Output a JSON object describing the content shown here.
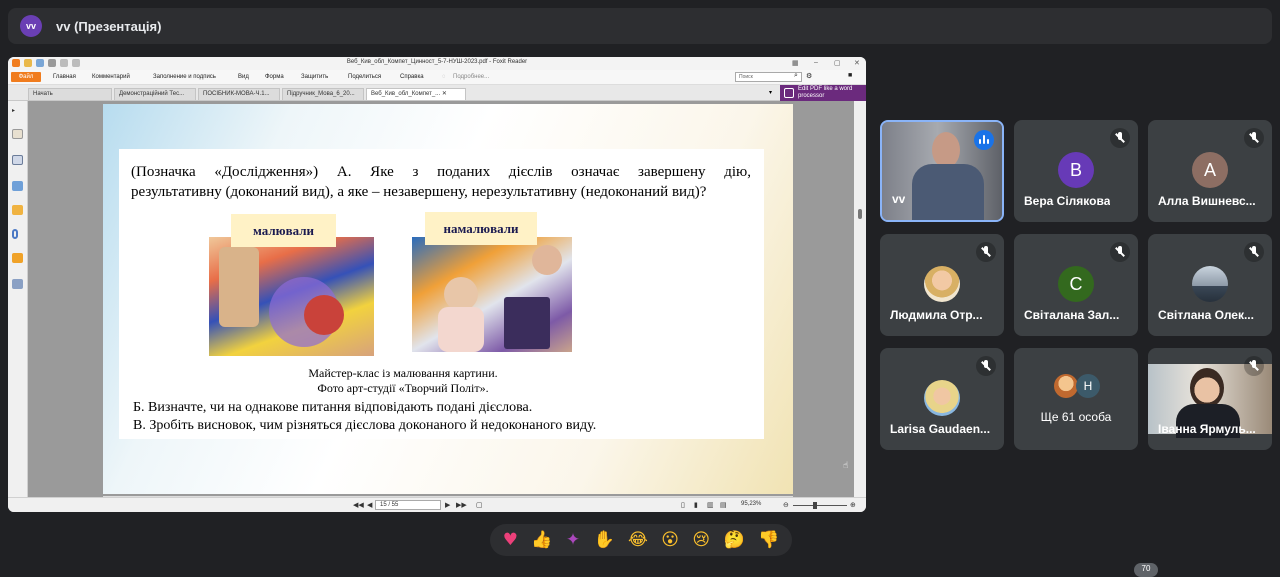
{
  "top_bar": {
    "avatar": "vv",
    "title": "vv (Презентація)"
  },
  "reader": {
    "title": "Веб_Кив_обл_Компет_Цинност_5-7-НУШ-2023.pdf - Foxit Reader",
    "menu": [
      "Файл",
      "Главная",
      "Комментарий",
      "Заполнение и подпись",
      "Вид",
      "Форма",
      "Защитить",
      "Поделиться",
      "Справка"
    ],
    "help_hint": "Подробнее...",
    "search_placeholder": "Поиск",
    "tabs": [
      "Начать",
      "Демонстраційний Тес...",
      "ПОСІБНИК-МОВА-Ч.1...",
      "Підручник_Мова_6_20...",
      "Веб_Кив_обл_Компет_..."
    ],
    "edit_pdf": "Edit PDF like a word processor",
    "page_indicator": "15 / 55",
    "zoom": "95,23%"
  },
  "slide": {
    "line1": "(Позначка «Дослідження») А. Яке з поданих дієслів означає завершену дію,",
    "line2": "результативну (доконаний вид), а яке – незавершену, нерезультативну (недоконаний вид)?",
    "label1": "малювали",
    "label2": "намалювали",
    "caption1": "Майстер-клас із малювання картини.",
    "caption2": "Фото арт-студії «Творчий Політ».",
    "part_b": "Б. Визначте, чи на однакове питання відповідають подані дієслова.",
    "part_c": "В. Зробіть висновок, чим різняться дієслова доконаного й недоконаного виду."
  },
  "participants": [
    {
      "name": "vv",
      "type": "video"
    },
    {
      "name": "Вера Сілякова",
      "initial": "В",
      "color": "#673ab7"
    },
    {
      "name": "Алла Вишневс...",
      "initial": "А",
      "color": "#8d6e63"
    },
    {
      "name": "Людмила Отр...",
      "type": "photo"
    },
    {
      "name": "Світалана Зал...",
      "initial": "С",
      "color": "#33691e"
    },
    {
      "name": "Світлана Олек...",
      "type": "photo"
    },
    {
      "name": "Larisa Gaudaen...",
      "type": "photo"
    },
    {
      "name": "Ще 61 особа",
      "initial": "H",
      "type": "more"
    },
    {
      "name": "Іванна Ярмуль...",
      "type": "video"
    }
  ],
  "reactions": [
    "heart-icon",
    "thumbs-up-icon",
    "party-icon",
    "clap-icon",
    "laugh-icon",
    "surprised-icon",
    "sad-icon",
    "thinking-icon",
    "thumbs-down-icon"
  ],
  "corner_badge": "70"
}
